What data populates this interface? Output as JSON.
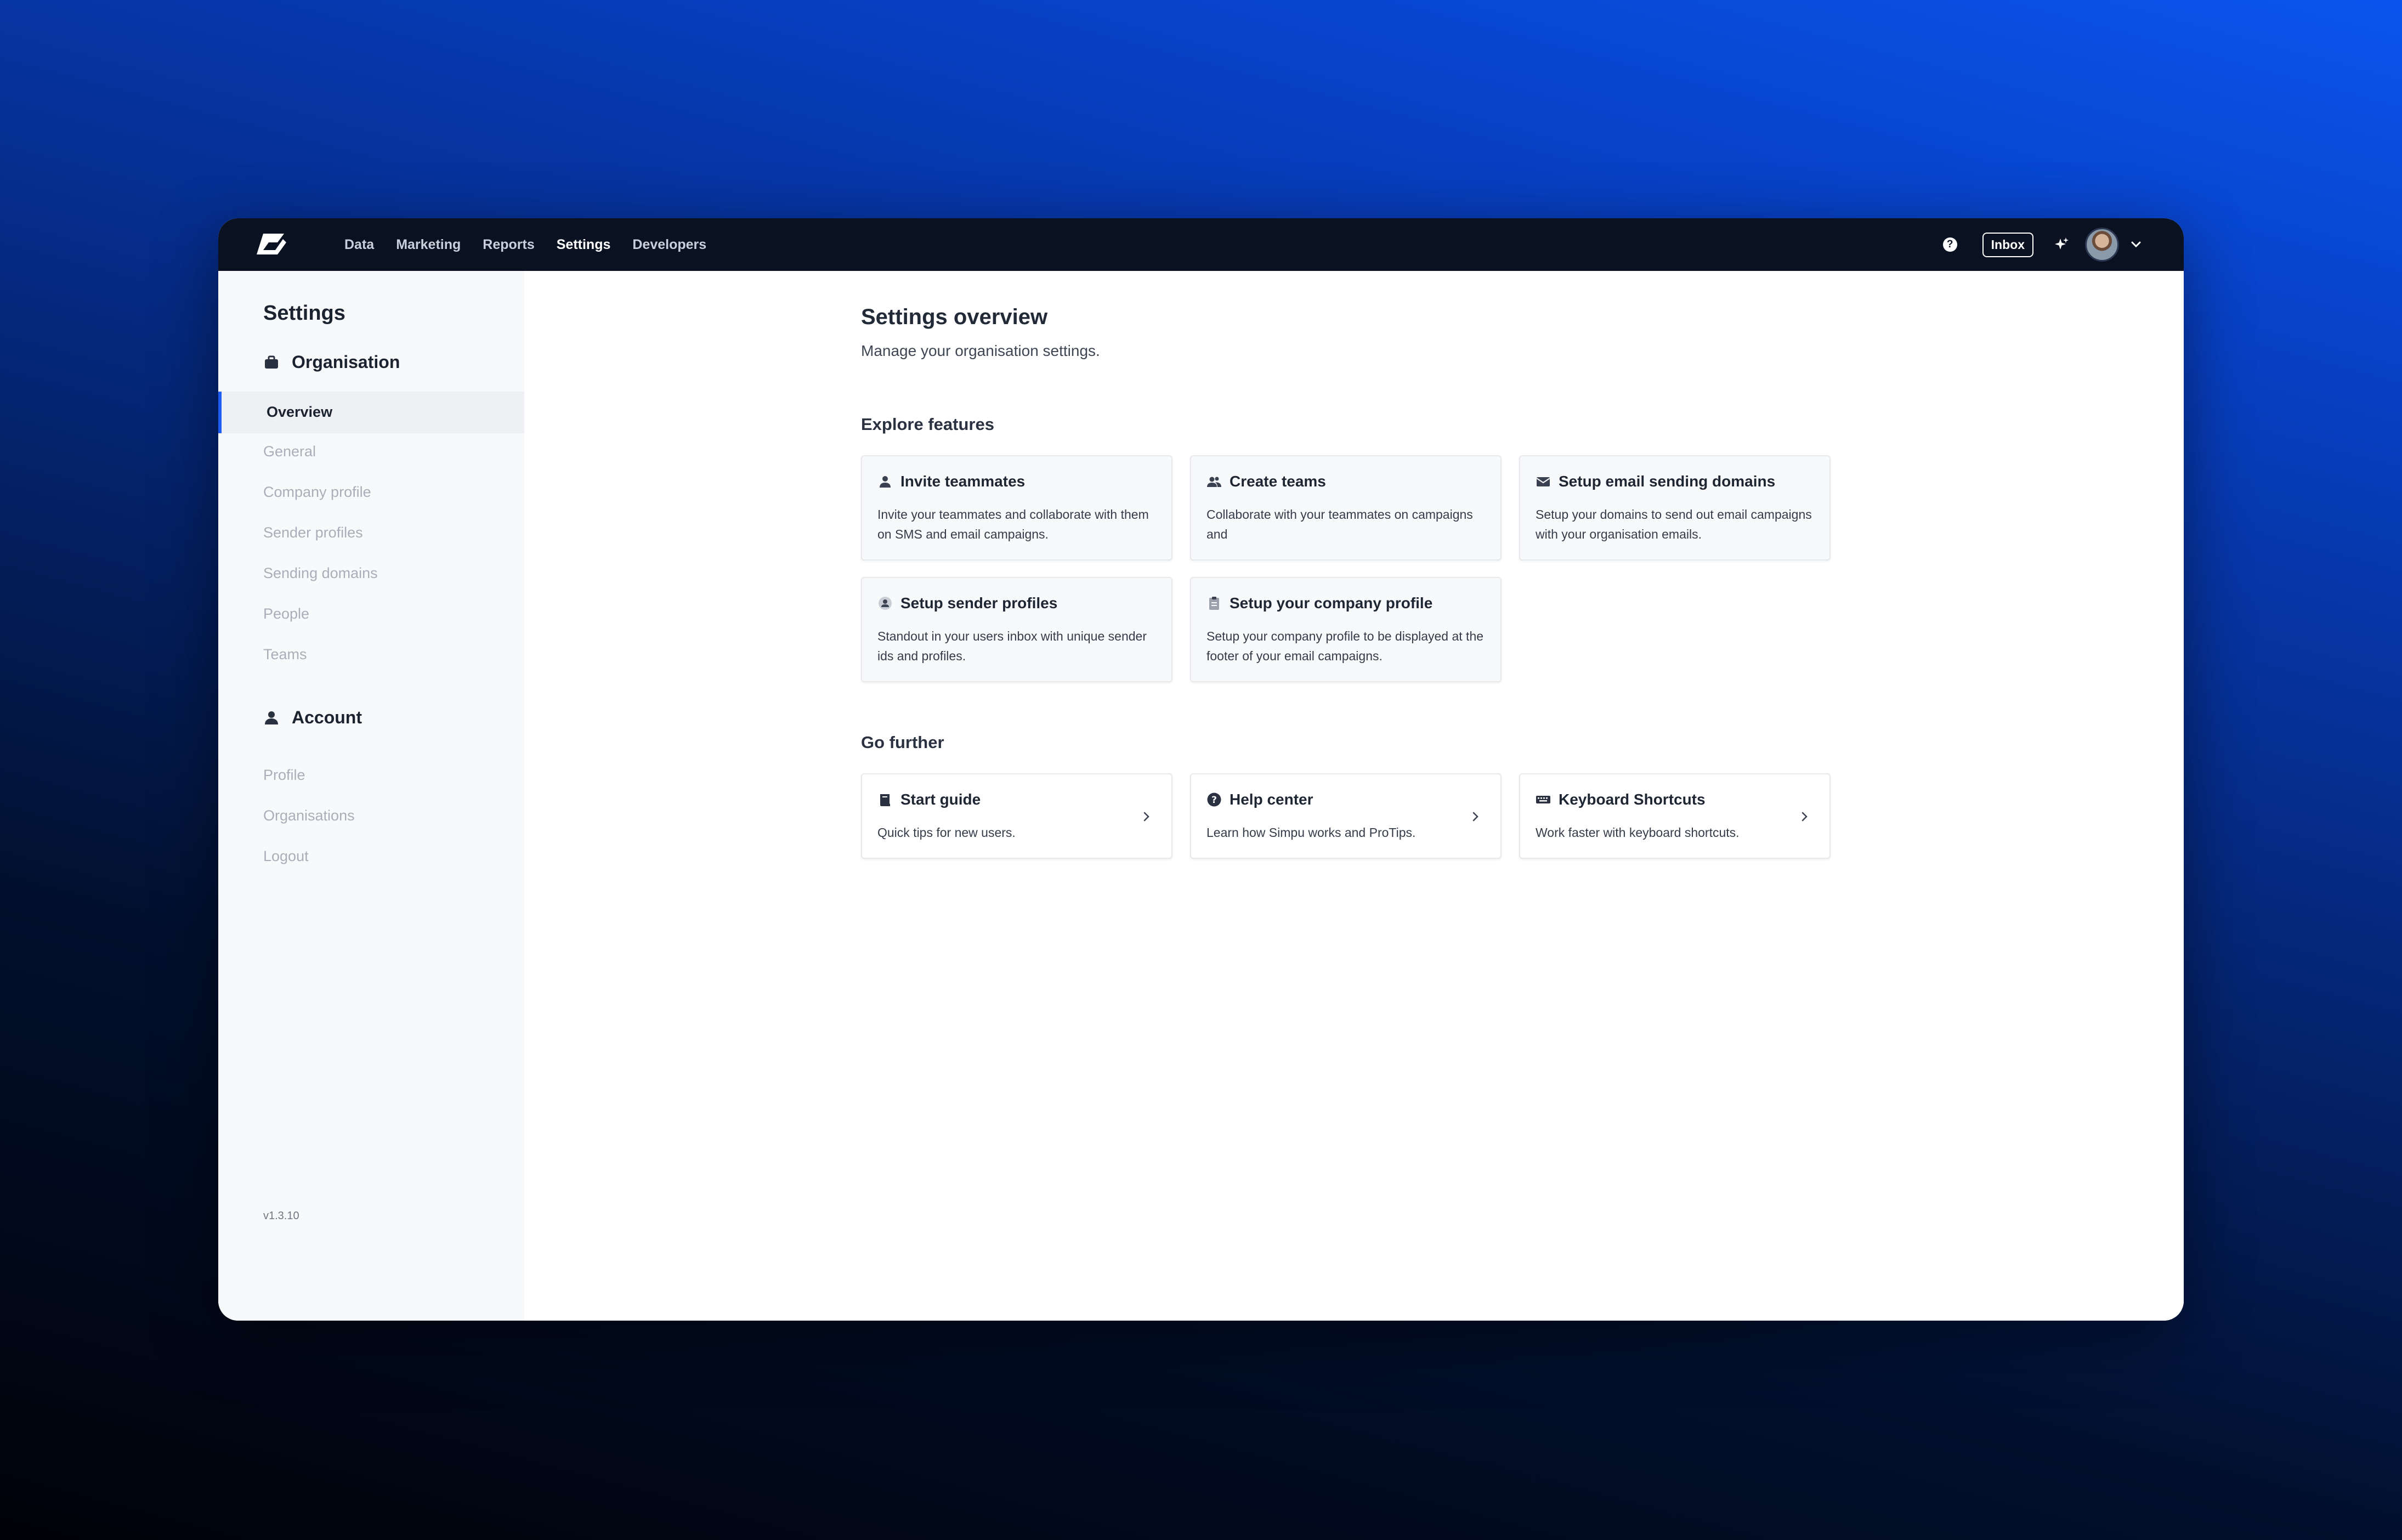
{
  "nav": {
    "links": [
      "Data",
      "Marketing",
      "Reports",
      "Settings",
      "Developers"
    ],
    "active": "Settings",
    "inbox_label": "Inbox",
    "help_glyph": "?"
  },
  "sidebar": {
    "title": "Settings",
    "organisation": {
      "label": "Organisation",
      "icon": "briefcase-icon",
      "active_item": "Overview",
      "items": [
        "General",
        "Company profile",
        "Sender profiles",
        "Sending domains",
        "People",
        "Teams"
      ]
    },
    "account": {
      "label": "Account",
      "icon": "user-icon",
      "items": [
        "Profile",
        "Organisations",
        "Logout"
      ]
    },
    "version": "v1.3.10"
  },
  "main": {
    "title": "Settings overview",
    "subtitle": "Manage your organisation settings.",
    "explore_heading": "Explore features",
    "features": [
      {
        "title": "Invite teammates",
        "desc": "Invite your teammates and collaborate with them on SMS and email campaigns.",
        "icon": "user-icon"
      },
      {
        "title": "Create teams",
        "desc": "Collaborate with your teammates on campaigns and",
        "icon": "users-icon"
      },
      {
        "title": "Setup email sending domains",
        "desc": "Setup your domains to send out email campaigns with your organisation emails.",
        "icon": "envelope-icon"
      },
      {
        "title": "Setup sender profiles",
        "desc": "Standout in your users inbox with unique sender ids and profiles.",
        "icon": "profile-circle-icon"
      },
      {
        "title": "Setup your company profile",
        "desc": "Setup your company profile to be displayed at the footer of your email campaigns.",
        "icon": "clipboard-icon"
      }
    ],
    "further_heading": "Go further",
    "further": [
      {
        "title": "Start guide",
        "desc": "Quick tips for new users.",
        "icon": "book-icon"
      },
      {
        "title": "Help center",
        "desc": "Learn how Simpu works and ProTips.",
        "icon": "question-circle-icon"
      },
      {
        "title": "Keyboard Shortcuts",
        "desc": "Work faster with keyboard shortcuts.",
        "icon": "keyboard-icon"
      }
    ]
  },
  "colors": {
    "accent": "#1e5bf0",
    "nav_bg": "#0a1120",
    "sidebar_bg": "#f8f9fa"
  }
}
